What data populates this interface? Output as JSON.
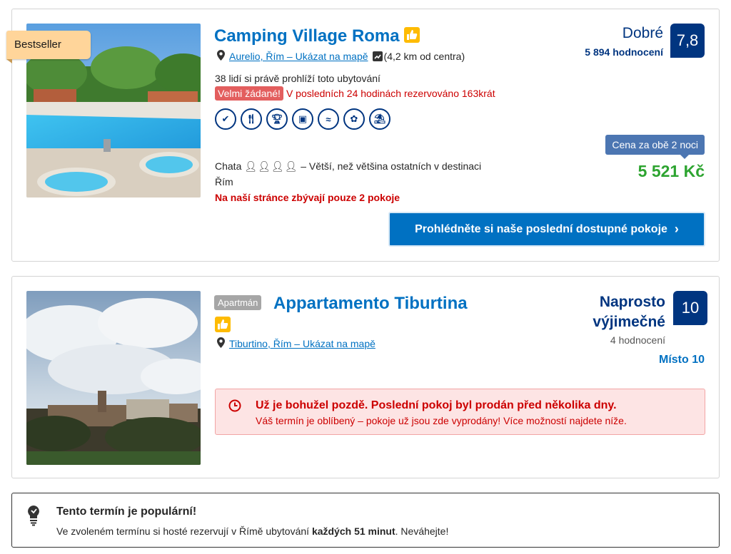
{
  "colors": {
    "brand_blue": "#003580",
    "link_blue": "#0071c2",
    "price_green": "#2da430",
    "alert_red": "#cc0000",
    "ribbon": "#ffd59a",
    "thumb_yellow": "#febb02"
  },
  "listings": [
    {
      "ribbon": "Bestseller",
      "name": "Camping Village Roma",
      "location_link": "Aurelio, Řím – Ukázat na mapě",
      "distance": "(4,2 km od centra)",
      "viewers": "38 lidí si právě prohlíží toto ubytování",
      "demand_badge": "Velmi žádané!",
      "demand_text": "V posledních 24 hodinách rezervováno 163krát",
      "amenities": [
        "verified-icon",
        "restaurant-icon",
        "trophy-icon",
        "tv-icon",
        "pool-icon",
        "wellness-icon",
        "beach-icon"
      ],
      "unit_type": "Chata",
      "unit_desc": "– Větší, než většina ostatních v destinaci",
      "unit_city": "Řím",
      "rooms_left": "Na naší stránce zbývají pouze 2 pokoje",
      "score_word": "Dobré",
      "score_count": "5 894 hodnocení",
      "score": "7,8",
      "price_label": "Cena za obě 2 noci",
      "price": "5 521 Kč",
      "cta": "Prohlédněte si naše poslední dostupné pokoje"
    },
    {
      "type_badge": "Apartmán",
      "name": "Appartamento Tiburtina",
      "location_link": "Tiburtino, Řím – Ukázat na mapě",
      "score_word_1": "Naprosto",
      "score_word_2": "výjimečné",
      "score_count": "4 hodnocení",
      "score": "10",
      "location_score": "Místo 10",
      "soldout_title": "Už je bohužel pozdě. Poslední pokoj byl prodán před několika dny.",
      "soldout_text": "Váš termín je oblíbený – pokoje už jsou zde vyprodány! Více možností najdete níže."
    }
  ],
  "notice": {
    "title": "Tento termín je populární!",
    "text_before": "Ve zvoleném termínu si hosté rezervují v Římě ubytování ",
    "text_bold": "každých 51 minut",
    "text_after": ". Neváhejte!"
  }
}
